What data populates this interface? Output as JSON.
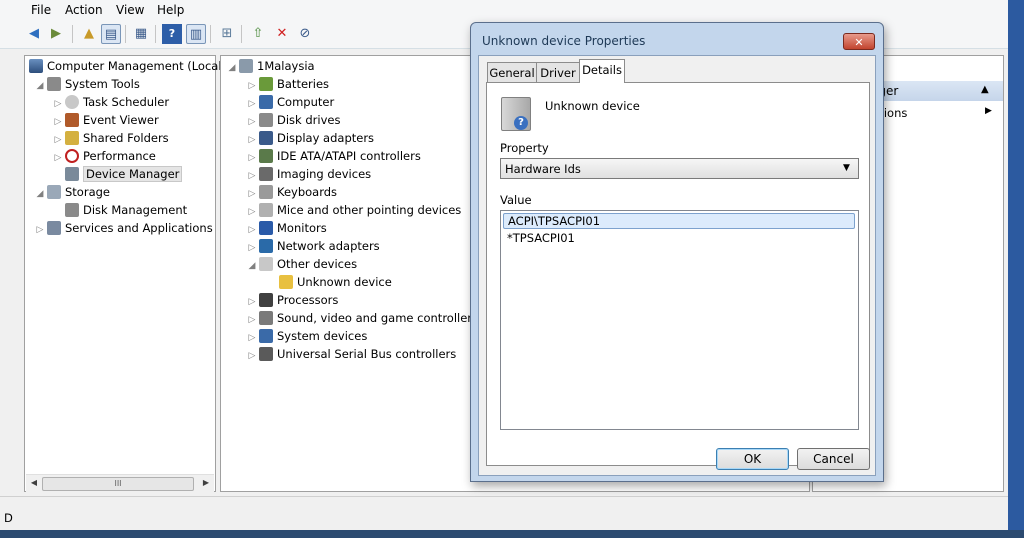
{
  "menu": [
    "File",
    "Action",
    "View",
    "Help"
  ],
  "toolbar_icons": [
    "back-icon",
    "forward-icon",
    "up-folder-icon",
    "show-tree-icon",
    "export-list-icon",
    "help-icon",
    "show-action-pane-icon",
    "scan-hardware-icon",
    "update-driver-icon",
    "uninstall-icon",
    "disable-icon"
  ],
  "left_tree": {
    "root": "Computer Management (Local",
    "system_tools": "System Tools",
    "task_scheduler": "Task Scheduler",
    "event_viewer": "Event Viewer",
    "shared_folders": "Shared Folders",
    "performance": "Performance",
    "device_manager": "Device Manager",
    "storage": "Storage",
    "disk_management": "Disk Management",
    "services": "Services and Applications"
  },
  "hscroll_grip": "III",
  "device_tree": {
    "root": "1Malaysia",
    "categories": [
      "Batteries",
      "Computer",
      "Disk drives",
      "Display adapters",
      "IDE ATA/ATAPI controllers",
      "Imaging devices",
      "Keyboards",
      "Mice and other pointing devices",
      "Monitors",
      "Network adapters",
      "Other devices"
    ],
    "unknown_device": "Unknown device",
    "categories_after": [
      "Processors",
      "Sound, video and game controllers",
      "System devices",
      "Universal Serial Bus controllers"
    ]
  },
  "actions_pane": {
    "header": "ager",
    "item": "ctions"
  },
  "dialog": {
    "title": "Unknown device Properties",
    "close": "✕",
    "tabs": [
      "General",
      "Driver",
      "Details"
    ],
    "device_name": "Unknown device",
    "property_label": "Property",
    "property_value": "Hardware Ids",
    "value_label": "Value",
    "values": [
      "ACPI\\TPSACPI01",
      "*TPSACPI01"
    ],
    "ok": "OK",
    "cancel": "Cancel"
  },
  "status_left": "D",
  "colors": {
    "selection": "#cde8ff",
    "title_text": "#1e3956",
    "accent": "#3c7fb1"
  }
}
